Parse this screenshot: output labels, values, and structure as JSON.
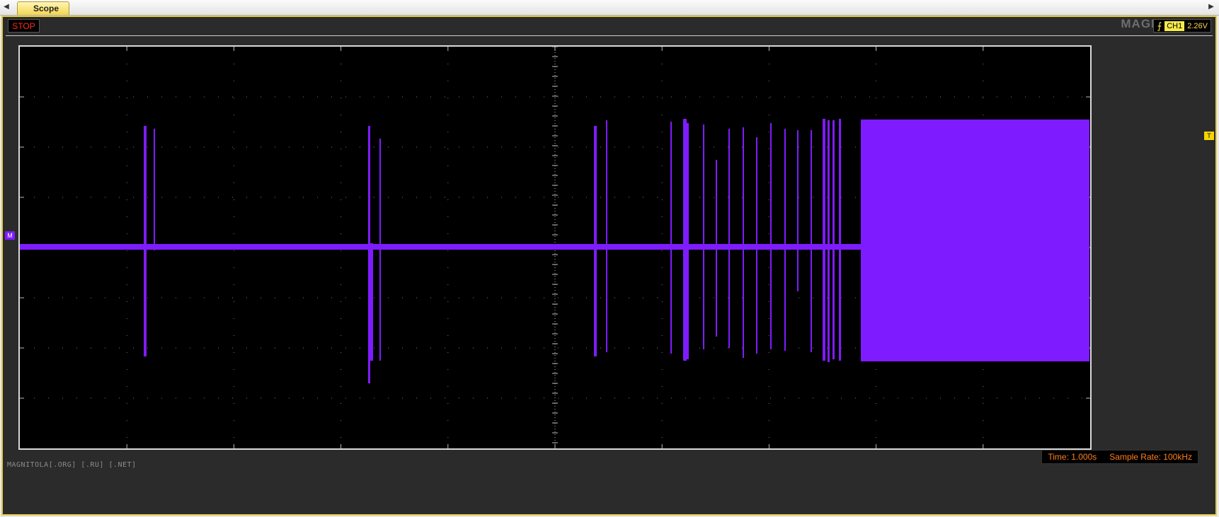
{
  "tab": {
    "label": "Scope"
  },
  "toolbar": {
    "stop_label": "STOP"
  },
  "trigger": {
    "channel": "CH1",
    "level": "2.26V",
    "edge_icon": "rising-edge-icon"
  },
  "watermark": {
    "logo": "MAGNITOLA",
    "url": "MAGNITOLA[.ORG] [.RU] [.NET]"
  },
  "markers": {
    "channel": "M",
    "trigger": "T"
  },
  "status": {
    "time": "Time: 1.000s",
    "sample_rate": "Sample Rate: 100kHz"
  },
  "colors": {
    "trace": "#7f1cff",
    "grid": "#7a7a7a",
    "frame": "#e2c94a",
    "status_text": "#ff7e1a",
    "stop_text": "#ff2b1a"
  }
}
